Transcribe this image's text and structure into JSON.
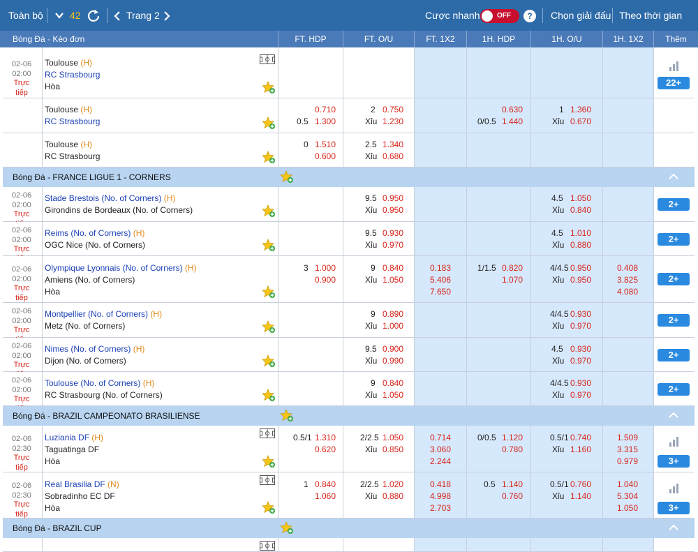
{
  "toolbar": {
    "all_label": "Toàn bộ",
    "count": "42",
    "page_label": "Trang 2",
    "quick_bet_label": "Cược nhanh",
    "toggle_state": "OFF",
    "help": "?",
    "choose_league": "Chọn giải đấu",
    "sort_time": "Theo thời gian"
  },
  "header": {
    "sport": "Bóng Đá - Kèo đơn",
    "ft_hdp": "FT. HDP",
    "ft_ou": "FT. O/U",
    "ft_1x2": "FT. 1X2",
    "h1_hdp": "1H. HDP",
    "h1_ou": "1H. O/U",
    "h1_1x2": "1H. 1X2",
    "more": "Thêm"
  },
  "block1": {
    "row1": {
      "date": "02-06",
      "time": "02:00",
      "live": "Trực tiếp",
      "home": "Toulouse",
      "home_tag": "(H)",
      "away": "RC Strasbourg",
      "draw": "Hòa",
      "more": "22+"
    },
    "row2": {
      "home": "Toulouse",
      "home_tag": "(H)",
      "away": "RC Strasbourg",
      "hdp_line": "0.5",
      "hdp_home": "0.710",
      "hdp_away": "1.300",
      "ou_line": "2",
      "ou_over": "0.750",
      "ou_under_label": "Xỉu",
      "ou_under": "1.230",
      "h1_hdp_line": "0/0.5",
      "h1_hdp_home": "0.630",
      "h1_hdp_away": "1.440",
      "h1_ou_line": "1",
      "h1_ou_over": "1.360",
      "h1_ou_under_label": "Xỉu",
      "h1_ou_under": "0.670"
    },
    "row3": {
      "home": "Toulouse",
      "home_tag": "(H)",
      "away": "RC Strasbourg",
      "hdp_line": "0",
      "hdp_home": "1.510",
      "hdp_away": "0.600",
      "ou_line": "2.5",
      "ou_over": "1.340",
      "ou_under_label": "Xỉu",
      "ou_under": "0.680"
    }
  },
  "league2": {
    "title": "Bóng Đá - FRANCE LIGUE 1 - CORNERS",
    "matches": [
      {
        "date": "02-06",
        "time": "02:00",
        "live": "Trực tiếp",
        "home": "Stade Brestois (No. of Corners)",
        "tag": "(H)",
        "away": "Girondins de Bordeaux (No. of Corners)",
        "ou_line": "9.5",
        "ou_over": "0.950",
        "ou_under_label": "Xỉu",
        "ou_under": "0.950",
        "h1_ou_line": "4.5",
        "h1_ou_over": "1.050",
        "h1_ou_under_label": "Xỉu",
        "h1_ou_under": "0.840",
        "more": "2+"
      },
      {
        "date": "02-06",
        "time": "02:00",
        "live": "Trực tiếp",
        "home": "Reims (No. of Corners)",
        "tag": "(H)",
        "away": "OGC Nice (No. of Corners)",
        "ou_line": "9.5",
        "ou_over": "0.930",
        "ou_under_label": "Xỉu",
        "ou_under": "0.970",
        "h1_ou_line": "4.5",
        "h1_ou_over": "1.010",
        "h1_ou_under_label": "Xỉu",
        "h1_ou_under": "0.880",
        "more": "2+"
      },
      {
        "date": "02-06",
        "time": "02:00",
        "live": "Trực tiếp",
        "home": "Olympique Lyonnais (No. of Corners)",
        "tag": "(H)",
        "away": "Amiens (No. of Corners)",
        "draw": "Hòa",
        "hdp_line": "3",
        "hdp_home": "1.000",
        "hdp_away": "0.900",
        "ou_line": "9",
        "ou_over": "0.840",
        "ou_under_label": "Xỉu",
        "ou_under": "1.050",
        "x_home": "0.183",
        "x_away": "5.406",
        "x_draw": "7.650",
        "h1_hdp_line": "1/1.5",
        "h1_hdp_home": "0.820",
        "h1_hdp_away": "1.070",
        "h1_ou_line": "4/4.5",
        "h1_ou_over": "0.950",
        "h1_ou_under_label": "Xỉu",
        "h1_ou_under": "0.950",
        "h1x_home": "0.408",
        "h1x_away": "3.825",
        "h1x_draw": "4.080",
        "more": "2+"
      },
      {
        "date": "02-06",
        "time": "02:00",
        "live": "Trực tiếp",
        "home": "Montpellier (No. of Corners)",
        "tag": "(H)",
        "away": "Metz (No. of Corners)",
        "ou_line": "9",
        "ou_over": "0.890",
        "ou_under_label": "Xỉu",
        "ou_under": "1.000",
        "h1_ou_line": "4/4.5",
        "h1_ou_over": "0.930",
        "h1_ou_under_label": "Xỉu",
        "h1_ou_under": "0.970",
        "more": "2+"
      },
      {
        "date": "02-06",
        "time": "02:00",
        "live": "Trực tiếp",
        "home": "Nimes (No. of Corners)",
        "tag": "(H)",
        "away": "Dijon (No. of Corners)",
        "ou_line": "9.5",
        "ou_over": "0.900",
        "ou_under_label": "Xỉu",
        "ou_under": "0.990",
        "h1_ou_line": "4.5",
        "h1_ou_over": "0.930",
        "h1_ou_under_label": "Xỉu",
        "h1_ou_under": "0.970",
        "more": "2+"
      },
      {
        "date": "02-06",
        "time": "02:00",
        "live": "Trực tiếp",
        "home": "Toulouse (No. of Corners)",
        "tag": "(H)",
        "away": "RC Strasbourg (No. of Corners)",
        "ou_line": "9",
        "ou_over": "0.840",
        "ou_under_label": "Xỉu",
        "ou_under": "1.050",
        "h1_ou_line": "4/4.5",
        "h1_ou_over": "0.930",
        "h1_ou_under_label": "Xỉu",
        "h1_ou_under": "0.970",
        "more": "2+"
      }
    ]
  },
  "league3": {
    "title": "Bóng Đá - BRAZIL CAMPEONATO BRASILIENSE",
    "matches": [
      {
        "date": "02-06",
        "time": "02:30",
        "live": "Trực tiếp",
        "home": "Luziania DF",
        "tag": "(H)",
        "away": "Taguatinga DF",
        "draw": "Hòa",
        "hdp_line": "0.5/1",
        "hdp_home": "1.310",
        "hdp_away": "0.620",
        "ou_line": "2/2.5",
        "ou_over": "1.050",
        "ou_under_label": "Xỉu",
        "ou_under": "0.850",
        "x_home": "0.714",
        "x_away": "3.060",
        "x_draw": "2.244",
        "h1_hdp_line": "0/0.5",
        "h1_hdp_home": "1.120",
        "h1_hdp_away": "0.780",
        "h1_ou_line": "0.5/1",
        "h1_ou_over": "0.740",
        "h1_ou_under_label": "Xỉu",
        "h1_ou_under": "1.160",
        "h1x_home": "1.509",
        "h1x_away": "3.315",
        "h1x_draw": "0.979",
        "more": "3+"
      },
      {
        "date": "02-06",
        "time": "02:30",
        "live": "Trực tiếp",
        "home": "Real Brasilia DF",
        "tag": "(N)",
        "away": "Sobradinho EC DF",
        "draw": "Hòa",
        "hdp_line": "1",
        "hdp_home": "0.840",
        "hdp_away": "1.060",
        "ou_line": "2/2.5",
        "ou_over": "1.020",
        "ou_under_label": "Xỉu",
        "ou_under": "0.880",
        "x_home": "0.418",
        "x_away": "4.998",
        "x_draw": "2.703",
        "h1_hdp_line": "0.5",
        "h1_hdp_home": "1.140",
        "h1_hdp_away": "0.760",
        "h1_ou_line": "0.5/1",
        "h1_ou_over": "0.760",
        "h1_ou_under_label": "Xỉu",
        "h1_ou_under": "1.140",
        "h1x_home": "1.040",
        "h1x_away": "5.304",
        "h1x_draw": "1.050",
        "more": "3+"
      }
    ]
  },
  "league4": {
    "title": "Bóng Đá - BRAZIL CUP"
  },
  "colors": {
    "header": "#2d6aa8",
    "columns": "#4a7ab8",
    "league_bar": "#b8d4f1",
    "highlight": "#d6e8fb",
    "odds": "#d8261c",
    "home_team": "#1a3fb5",
    "tag": "#e08a1a",
    "more_button": "#2a8ae0"
  },
  "icons": [
    "chevron-down-icon",
    "refresh-icon",
    "chevron-left-icon",
    "chevron-right-icon",
    "help-icon",
    "favorite-star-icon",
    "field-icon",
    "stats-bars-icon",
    "collapse-up-icon"
  ]
}
